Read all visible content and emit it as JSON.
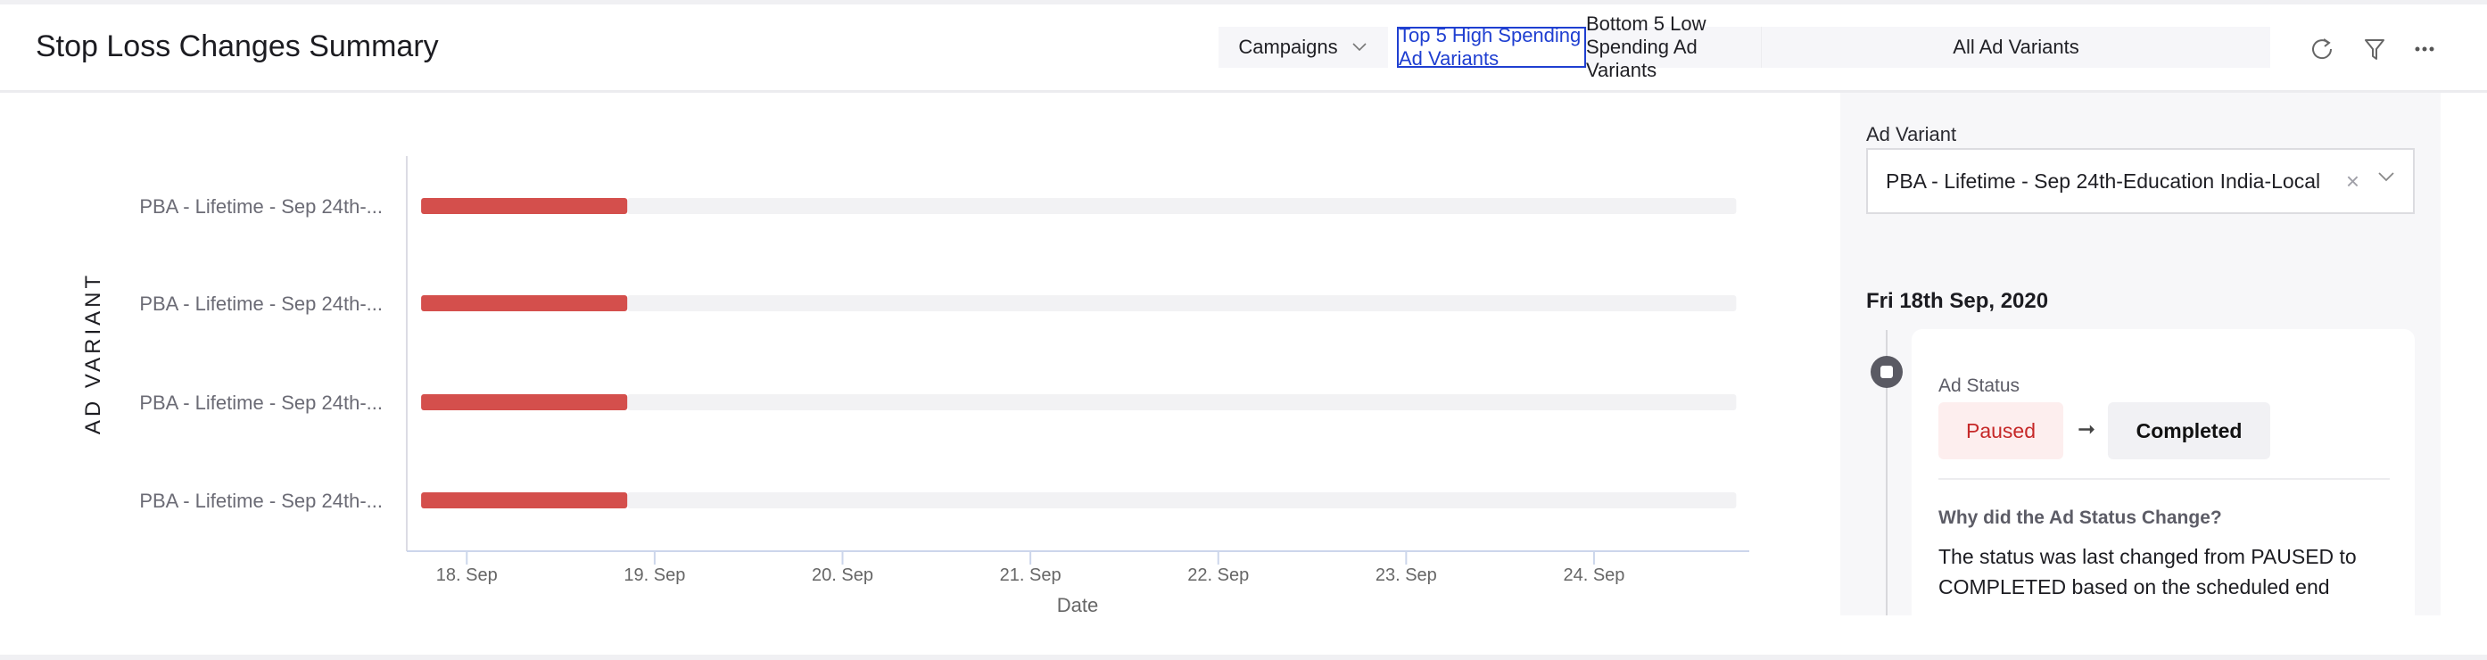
{
  "header": {
    "title": "Stop Loss Changes Summary",
    "campaigns_label": "Campaigns",
    "tabs": [
      {
        "label": "Top 5 High Spending Ad Variants",
        "active": true
      },
      {
        "label": "Bottom 5 Low Spending Ad Variants",
        "active": false
      },
      {
        "label": "All Ad Variants",
        "active": false
      }
    ],
    "icons": [
      "refresh-icon",
      "filter-icon",
      "more-icon"
    ],
    "accent_color": "#1f3fd1"
  },
  "chart_data": {
    "type": "bar",
    "orientation": "horizontal-range",
    "xlabel": "Date",
    "ylabel": "AD VARIANT",
    "categories": [
      "PBA - Lifetime - Sep 24th-...",
      "PBA - Lifetime - Sep 24th-...",
      "PBA - Lifetime - Sep 24th-...",
      "PBA - Lifetime - Sep 24th-..."
    ],
    "xlim": [
      "2020-09-17T16:20",
      "2020-09-24T19:50"
    ],
    "x_ticks": [
      {
        "date": "2020-09-18",
        "label": "18. Sep"
      },
      {
        "date": "2020-09-19",
        "label": "19. Sep"
      },
      {
        "date": "2020-09-20",
        "label": "20. Sep"
      },
      {
        "date": "2020-09-21",
        "label": "21. Sep"
      },
      {
        "date": "2020-09-22",
        "label": "22. Sep"
      },
      {
        "date": "2020-09-23",
        "label": "23. Sep"
      },
      {
        "date": "2020-09-24",
        "label": "24. Sep"
      }
    ],
    "series": [
      {
        "status": "Paused",
        "color": "#d44f4c",
        "ranges": [
          [
            "2020-09-17T18:10",
            "2020-09-18T20:30"
          ],
          [
            "2020-09-17T18:10",
            "2020-09-18T20:30"
          ],
          [
            "2020-09-17T18:10",
            "2020-09-18T20:30"
          ],
          [
            "2020-09-17T18:10",
            "2020-09-18T20:30"
          ]
        ]
      },
      {
        "status": "Completed",
        "color": "#f2f2f4",
        "ranges": [
          [
            "2020-09-18T20:30",
            "2020-09-24T18:10"
          ],
          [
            "2020-09-18T20:30",
            "2020-09-24T18:10"
          ],
          [
            "2020-09-18T20:30",
            "2020-09-24T18:10"
          ],
          [
            "2020-09-18T20:30",
            "2020-09-24T18:10"
          ]
        ]
      }
    ],
    "grid": false,
    "legend": "none"
  },
  "panel": {
    "ad_variant_label": "Ad Variant",
    "ad_variant_value": "PBA - Lifetime - Sep 24th-Education India-Local",
    "date_heading": "Fri 18th Sep, 2020",
    "change": {
      "title": "Ad Status",
      "from": "Paused",
      "to": "Completed",
      "arrow": "➞",
      "why_title": "Why did the Ad Status Change?",
      "reason": "The status was last changed from PAUSED to COMPLETED based on the scheduled end"
    }
  }
}
